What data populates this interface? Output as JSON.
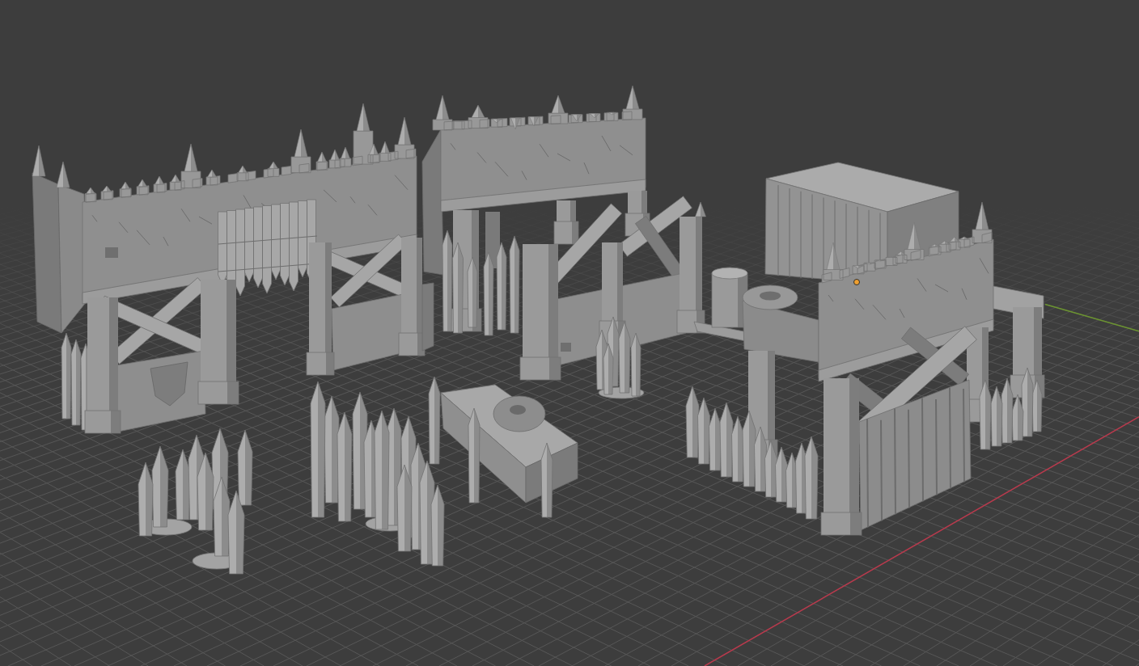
{
  "viewport": {
    "axes": [
      {
        "kind": "x",
        "color": "#b8394c"
      },
      {
        "kind": "y",
        "color": "#6c9431"
      }
    ],
    "objects": [
      {
        "kind": "palisade-gate",
        "selected": false
      },
      {
        "kind": "gate-tower",
        "selected": false
      },
      {
        "kind": "gate-wall",
        "selected": false
      },
      {
        "kind": "stake-cluster",
        "selected": false
      },
      {
        "kind": "watchtower",
        "selected": true
      },
      {
        "kind": "stake-cluster",
        "selected": false
      },
      {
        "kind": "stake-cluster",
        "selected": false
      },
      {
        "kind": "tire-barricade",
        "selected": false
      }
    ]
  }
}
